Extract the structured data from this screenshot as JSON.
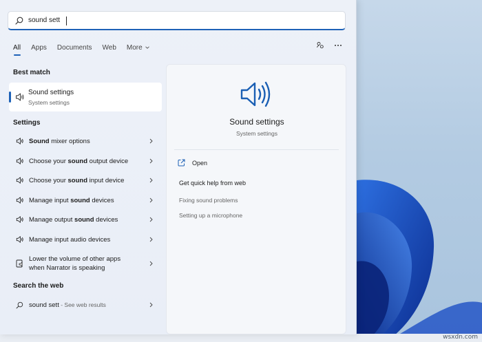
{
  "search": {
    "query": "sound sett",
    "placeholder": ""
  },
  "tabs": [
    {
      "label": "All"
    },
    {
      "label": "Apps"
    },
    {
      "label": "Documents"
    },
    {
      "label": "Web"
    },
    {
      "label": "More"
    }
  ],
  "sections": {
    "best_match": "Best match",
    "settings": "Settings",
    "search_web": "Search the web"
  },
  "best_match": {
    "title": "Sound settings",
    "subtitle": "System settings"
  },
  "settings_results": [
    {
      "pre": "",
      "bold": "Sound",
      "post": " mixer options"
    },
    {
      "pre": "Choose your ",
      "bold": "sound",
      "post": " output device"
    },
    {
      "pre": "Choose your ",
      "bold": "sound",
      "post": " input device"
    },
    {
      "pre": "Manage input ",
      "bold": "sound",
      "post": " devices"
    },
    {
      "pre": "Manage output ",
      "bold": "sound",
      "post": " devices"
    },
    {
      "pre": "Manage input audio devices",
      "bold": "",
      "post": ""
    },
    {
      "line1": "Lower the volume of other apps",
      "line2": "when Narrator is speaking"
    }
  ],
  "web_result": {
    "query": "sound sett",
    "suffix": " - See web results"
  },
  "preview": {
    "title": "Sound settings",
    "subtitle": "System settings",
    "open_label": "Open",
    "quick_help": "Get quick help from web",
    "help_links": [
      "Fixing sound problems",
      "Setting up a microphone"
    ]
  },
  "colors": {
    "accent": "#1d61b7",
    "icon_blue": "#1a5fb4"
  },
  "watermark": "wsxdn.com"
}
